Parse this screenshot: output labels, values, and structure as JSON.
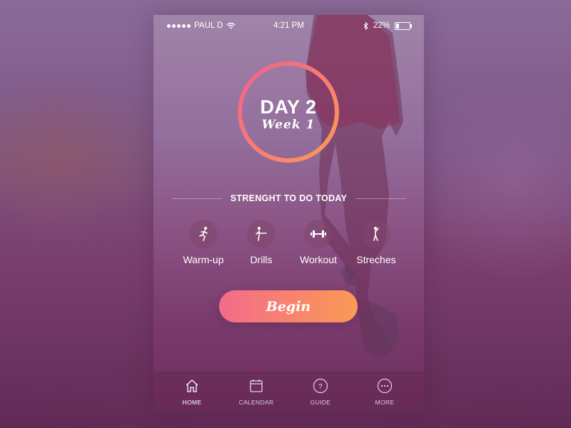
{
  "status_bar": {
    "carrier": "PAUL D",
    "time": "4:21 PM",
    "battery": "22%",
    "battery_level": 0.22
  },
  "hero": {
    "day": "DAY 2",
    "week": "Week 1"
  },
  "section_title": "STRENGHT TO DO TODAY",
  "activities": [
    {
      "label": "Warm-up",
      "icon": "running-icon"
    },
    {
      "label": "Drills",
      "icon": "kick-icon"
    },
    {
      "label": "Workout",
      "icon": "dumbbell-icon"
    },
    {
      "label": "Streches",
      "icon": "stretch-icon"
    }
  ],
  "begin_label": "Begin",
  "tabs": [
    {
      "label": "HOME",
      "icon": "home-icon",
      "active": true
    },
    {
      "label": "CALENDAR",
      "icon": "calendar-icon",
      "active": false
    },
    {
      "label": "GUIDE",
      "icon": "question-icon",
      "active": false
    },
    {
      "label": "MORE",
      "icon": "more-icon",
      "active": false
    }
  ],
  "colors": {
    "accent_start": "#f46b8a",
    "accent_end": "#fa9a55",
    "ring_start": "#f25f8f",
    "ring_end": "#fb9a58"
  }
}
